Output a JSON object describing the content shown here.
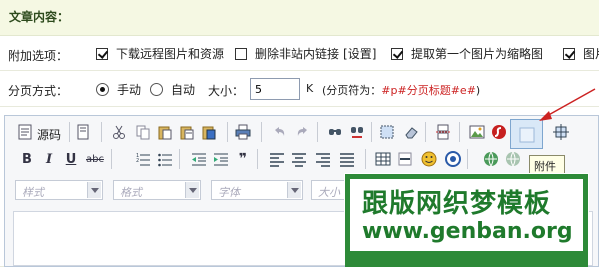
{
  "section": {
    "title": "文章内容："
  },
  "attach": {
    "label": "附加选项：",
    "opt1": "下载远程图片和资源",
    "opt2": "删除非站内链接",
    "opt2_link": "[设置]",
    "opt3": "提取第一个图片为缩略图",
    "opt4": "图片"
  },
  "paging": {
    "label": "分页方式：",
    "manual": "手动",
    "auto": "自动",
    "size_label": "大小：",
    "size_value": "5",
    "unit": "K",
    "separator_note_prefix": "(分页符为：",
    "separator_code": "#p#分页标题#e#",
    "separator_note_suffix": ")"
  },
  "editor": {
    "source_label": "源码",
    "tooltip": "附件",
    "combos": {
      "style": "样式",
      "format": "格式",
      "font": "字体",
      "size": "大小"
    },
    "icons_row1": [
      "source-icon",
      "templates-icon",
      "cut-icon",
      "copy-icon",
      "paste-icon",
      "paste-text-icon",
      "paste-word-icon",
      "print-icon",
      "undo-icon",
      "redo-icon",
      "find-icon",
      "replace-icon",
      "select-all-icon",
      "remove-format-icon",
      "page-break-icon",
      "image-icon",
      "flash-icon",
      "attachment-icon",
      "anchor-icon"
    ],
    "icons_row2": [
      "bold-icon",
      "italic-icon",
      "underline-icon",
      "strike-icon",
      "ordered-list-icon",
      "bullet-list-icon",
      "outdent-icon",
      "indent-icon",
      "blockquote-icon",
      "align-left-icon",
      "align-center-icon",
      "align-right-icon",
      "justify-icon",
      "table-icon",
      "hr-icon",
      "smiley-icon",
      "special-char-icon",
      "link-icon",
      "unlink-icon"
    ]
  },
  "watermark": {
    "line1": "跟版网织梦模板",
    "line2": "www.genban.org"
  },
  "colors": {
    "accent_red": "#cc2222",
    "watermark_green": "#1f7a2c",
    "header_bg": "#f5f8e3"
  }
}
